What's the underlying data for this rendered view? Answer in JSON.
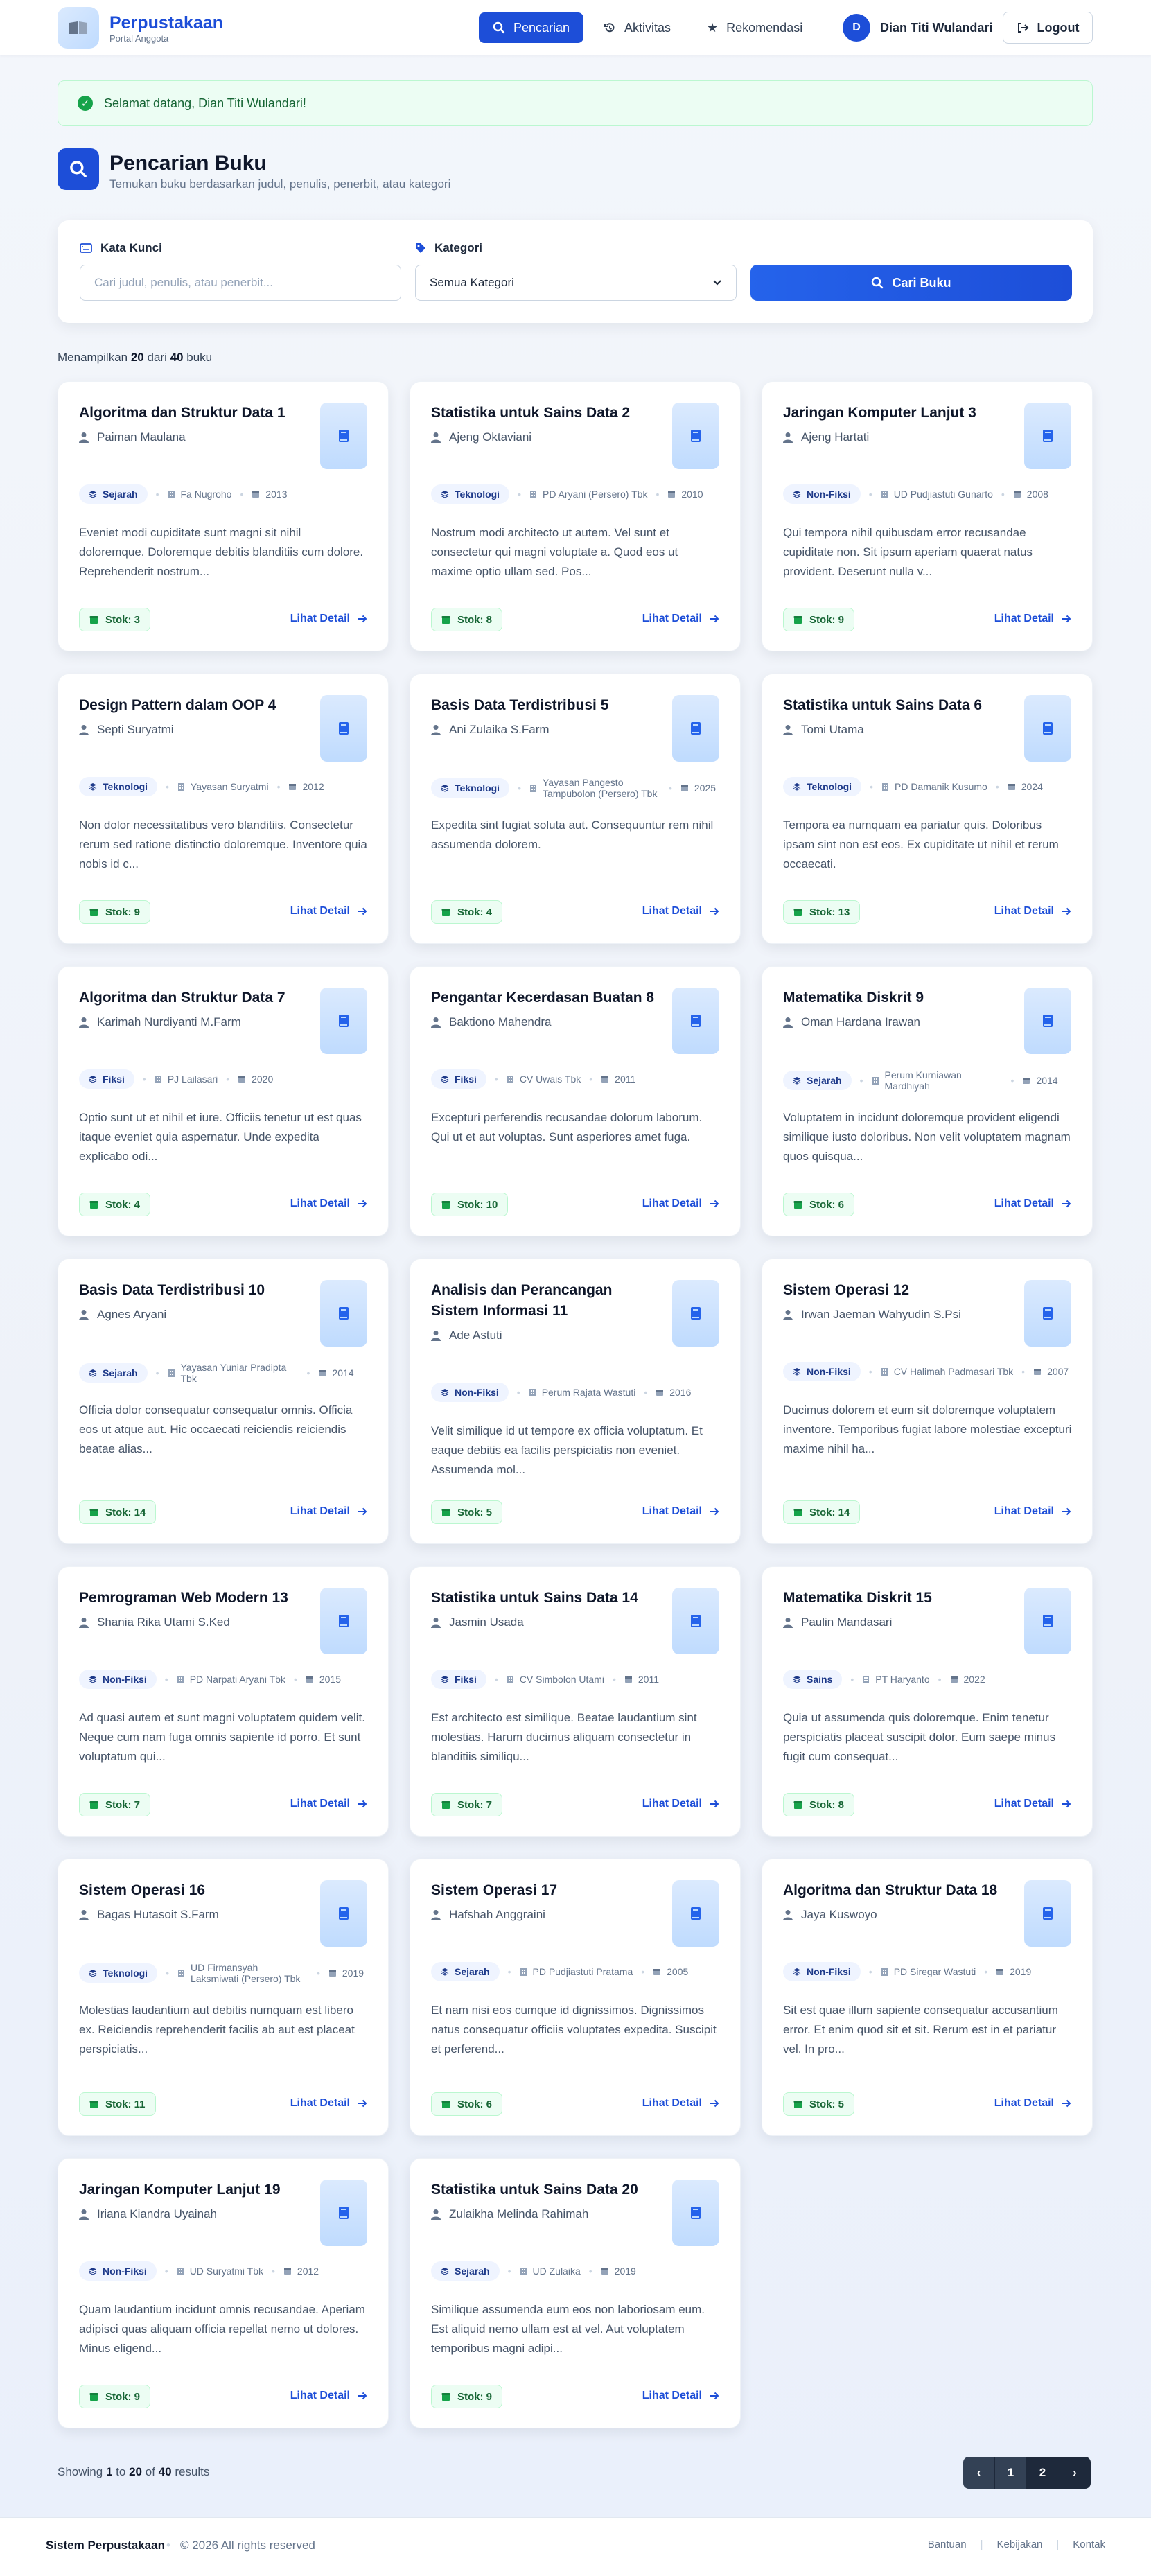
{
  "header": {
    "brand_title": "Perpustakaan",
    "brand_subtitle": "Portal Anggota",
    "nav": [
      {
        "label": "Pencarian",
        "icon": "search-icon",
        "active": true
      },
      {
        "label": "Aktivitas",
        "icon": "history-icon",
        "active": false
      },
      {
        "label": "Rekomendasi",
        "icon": "star-icon",
        "active": false
      }
    ],
    "user_initial": "D",
    "user_name": "Dian Titi Wulandari",
    "logout_label": "Logout"
  },
  "alert": {
    "message": "Selamat datang, Dian Titi Wulandari!"
  },
  "page": {
    "title": "Pencarian Buku",
    "subtitle": "Temukan buku berdasarkan judul, penulis, penerbit, atau kategori"
  },
  "search": {
    "keyword_label": "Kata Kunci",
    "keyword_placeholder": "Cari judul, penulis, atau penerbit...",
    "category_label": "Kategori",
    "category_value": "Semua Kategori",
    "button_label": "Cari Buku"
  },
  "results_summary": {
    "prefix": "Menampilkan",
    "shown": "20",
    "middle": "dari",
    "total": "40",
    "suffix": "buku"
  },
  "detail_label": "Lihat Detail",
  "stock_prefix": "Stok:",
  "books": [
    {
      "title": "Algoritma dan Struktur Data 1",
      "author": "Paiman Maulana",
      "category": "Sejarah",
      "publisher": "Fa Nugroho",
      "year": "2013",
      "desc": "Eveniet modi cupiditate sunt magni sit nihil doloremque. Doloremque debitis blanditiis cum dolore. Reprehenderit nostrum...",
      "stock": "3"
    },
    {
      "title": "Statistika untuk Sains Data 2",
      "author": "Ajeng Oktaviani",
      "category": "Teknologi",
      "publisher": "PD Aryani (Persero) Tbk",
      "year": "2010",
      "desc": "Nostrum modi architecto ut autem. Vel sunt et consectetur qui magni voluptate a. Quod eos ut maxime optio ullam sed. Pos...",
      "stock": "8"
    },
    {
      "title": "Jaringan Komputer Lanjut 3",
      "author": "Ajeng Hartati",
      "category": "Non-Fiksi",
      "publisher": "UD Pudjiastuti Gunarto",
      "year": "2008",
      "desc": "Qui tempora nihil quibusdam error recusandae cupiditate non. Sit ipsum aperiam quaerat natus provident. Deserunt nulla v...",
      "stock": "9"
    },
    {
      "title": "Design Pattern dalam OOP 4",
      "author": "Septi Suryatmi",
      "category": "Teknologi",
      "publisher": "Yayasan Suryatmi",
      "year": "2012",
      "desc": "Non dolor necessitatibus vero blanditiis. Consectetur rerum sed ratione distinctio doloremque. Inventore quia nobis id c...",
      "stock": "9"
    },
    {
      "title": "Basis Data Terdistribusi 5",
      "author": "Ani Zulaika S.Farm",
      "category": "Teknologi",
      "publisher": "Yayasan Pangesto Tampubolon (Persero) Tbk",
      "year": "2025",
      "desc": "Expedita sint fugiat soluta aut. Consequuntur rem nihil assumenda dolorem.",
      "stock": "4"
    },
    {
      "title": "Statistika untuk Sains Data 6",
      "author": "Tomi Utama",
      "category": "Teknologi",
      "publisher": "PD Damanik Kusumo",
      "year": "2024",
      "desc": "Tempora ea numquam ea pariatur quis. Doloribus ipsam sint non est eos. Ex cupiditate ut nihil et rerum occaecati.",
      "stock": "13"
    },
    {
      "title": "Algoritma dan Struktur Data 7",
      "author": "Karimah Nurdiyanti M.Farm",
      "category": "Fiksi",
      "publisher": "PJ Lailasari",
      "year": "2020",
      "desc": "Optio sunt ut et nihil et iure. Officiis tenetur ut est quas itaque eveniet quia aspernatur. Unde expedita explicabo odi...",
      "stock": "4"
    },
    {
      "title": "Pengantar Kecerdasan Buatan 8",
      "author": "Baktiono Mahendra",
      "category": "Fiksi",
      "publisher": "CV Uwais Tbk",
      "year": "2011",
      "desc": "Excepturi perferendis recusandae dolorum laborum. Qui ut et aut voluptas. Sunt asperiores amet fuga.",
      "stock": "10"
    },
    {
      "title": "Matematika Diskrit 9",
      "author": "Oman Hardana Irawan",
      "category": "Sejarah",
      "publisher": "Perum Kurniawan Mardhiyah",
      "year": "2014",
      "desc": "Voluptatem in incidunt doloremque provident eligendi similique iusto doloribus. Non velit voluptatem magnam quos quisqua...",
      "stock": "6"
    },
    {
      "title": "Basis Data Terdistribusi 10",
      "author": "Agnes Aryani",
      "category": "Sejarah",
      "publisher": "Yayasan Yuniar Pradipta Tbk",
      "year": "2014",
      "desc": "Officia dolor consequatur consequatur omnis. Officia eos ut atque aut. Hic occaecati reiciendis reiciendis beatae alias...",
      "stock": "14"
    },
    {
      "title": "Analisis dan Perancangan Sistem Informasi 11",
      "author": "Ade Astuti",
      "category": "Non-Fiksi",
      "publisher": "Perum Rajata Wastuti",
      "year": "2016",
      "desc": "Velit similique id ut tempore ex officia voluptatum. Et eaque debitis ea facilis perspiciatis non eveniet. Assumenda mol...",
      "stock": "5"
    },
    {
      "title": "Sistem Operasi 12",
      "author": "Irwan Jaeman Wahyudin S.Psi",
      "category": "Non-Fiksi",
      "publisher": "CV Halimah Padmasari Tbk",
      "year": "2007",
      "desc": "Ducimus dolorem et eum sit doloremque voluptatem inventore. Temporibus fugiat labore molestiae excepturi maxime nihil ha...",
      "stock": "14"
    },
    {
      "title": "Pemrograman Web Modern 13",
      "author": "Shania Rika Utami S.Ked",
      "category": "Non-Fiksi",
      "publisher": "PD Narpati Aryani Tbk",
      "year": "2015",
      "desc": "Ad quasi autem et sunt magni voluptatem quidem velit. Neque cum nam fuga omnis sapiente id porro. Et sunt voluptatum qui...",
      "stock": "7"
    },
    {
      "title": "Statistika untuk Sains Data 14",
      "author": "Jasmin Usada",
      "category": "Fiksi",
      "publisher": "CV Simbolon Utami",
      "year": "2011",
      "desc": "Est architecto est similique. Beatae laudantium sint molestias. Harum ducimus aliquam consectetur in blanditiis similiqu...",
      "stock": "7"
    },
    {
      "title": "Matematika Diskrit 15",
      "author": "Paulin Mandasari",
      "category": "Sains",
      "publisher": "PT Haryanto",
      "year": "2022",
      "desc": "Quia ut assumenda quis doloremque. Enim tenetur perspiciatis placeat suscipit dolor. Eum saepe minus fugit cum consequat...",
      "stock": "8"
    },
    {
      "title": "Sistem Operasi 16",
      "author": "Bagas Hutasoit S.Farm",
      "category": "Teknologi",
      "publisher": "UD Firmansyah Laksmiwati (Persero) Tbk",
      "year": "2019",
      "desc": "Molestias laudantium aut debitis numquam est libero ex. Reiciendis reprehenderit facilis ab aut est placeat perspiciatis...",
      "stock": "11"
    },
    {
      "title": "Sistem Operasi 17",
      "author": "Hafshah Anggraini",
      "category": "Sejarah",
      "publisher": "PD Pudjiastuti Pratama",
      "year": "2005",
      "desc": "Et nam nisi eos cumque id dignissimos. Dignissimos natus consequatur officiis voluptates expedita. Suscipit et perferend...",
      "stock": "6"
    },
    {
      "title": "Algoritma dan Struktur Data 18",
      "author": "Jaya Kuswoyo",
      "category": "Non-Fiksi",
      "publisher": "PD Siregar Wastuti",
      "year": "2019",
      "desc": "Sit est quae illum sapiente consequatur accusantium error. Et enim quod sit et sit. Rerum est in et pariatur vel. In pro...",
      "stock": "5"
    },
    {
      "title": "Jaringan Komputer Lanjut 19",
      "author": "Iriana Kiandra Uyainah",
      "category": "Non-Fiksi",
      "publisher": "UD Suryatmi Tbk",
      "year": "2012",
      "desc": "Quam laudantium incidunt omnis recusandae. Aperiam adipisci quas aliquam officia repellat nemo ut dolores. Minus eligend...",
      "stock": "9"
    },
    {
      "title": "Statistika untuk Sains Data 20",
      "author": "Zulaikha Melinda Rahimah",
      "category": "Sejarah",
      "publisher": "UD Zulaika",
      "year": "2019",
      "desc": "Similique assumenda eum eos non laboriosam eum. Est aliquid nemo ullam est at vel. Aut voluptatem temporibus magni adipi...",
      "stock": "9"
    }
  ],
  "pagination": {
    "prefix": "Showing",
    "from": "1",
    "middle": "to",
    "to": "20",
    "of": "of",
    "total": "40",
    "suffix": "results",
    "prev": "‹",
    "pages": [
      "1",
      "2"
    ],
    "next": "›"
  },
  "footer": {
    "brand": "Sistem Perpustakaan",
    "copyright": "© 2026 All rights reserved",
    "links": [
      "Bantuan",
      "Kebijakan",
      "Kontak"
    ]
  },
  "colors": {
    "primary": "#1d4ed8",
    "success": "#16a34a",
    "background": "#f3f6fb"
  }
}
